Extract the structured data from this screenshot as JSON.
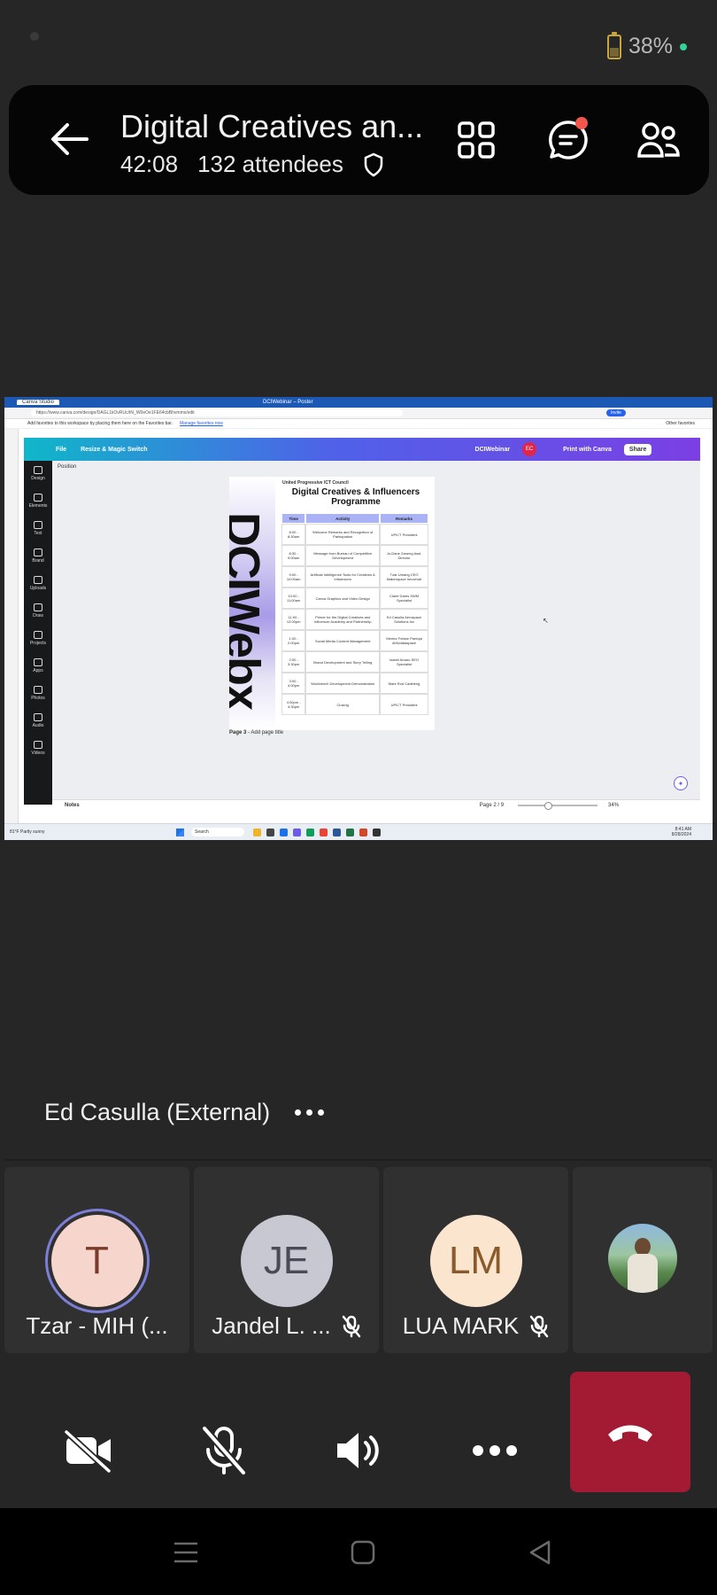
{
  "status_bar": {
    "battery": "38%"
  },
  "header": {
    "title": "Digital Creatives an...",
    "duration": "42:08",
    "attendees": "132 attendees"
  },
  "shared_screen": {
    "window_tab": "Canva Studio",
    "window_title": "DCIWebinar – Poster",
    "url": "https://www.canva.com/design/DAGL1kOvRUc/tN_W0eOe1FE64cbBhvmmx/edit",
    "invite": "Invite",
    "favbar_text": "Add favorites to this workspace by placing them here on the Favorites bar.",
    "favbar_link": "Manage favorites now",
    "other_favorites": "Other favorites",
    "canva": {
      "file": "File",
      "resize": "Resize & Magic Switch",
      "workspace_name": "DCIWebinar",
      "avatar": "EC",
      "print": "Print with Canva",
      "share": "Share",
      "position": "Position",
      "sidebar": [
        "Design",
        "Elements",
        "Text",
        "Brand",
        "Uploads",
        "Draw",
        "Projects",
        "Apps",
        "Photos",
        "Audio",
        "Videos"
      ],
      "page_label": "Page 3",
      "page_title_placeholder": "- Add page title",
      "notes": "Notes",
      "page_count": "Page 2 / 9",
      "zoom": "34%"
    },
    "poster": {
      "council": "United Progressive ICT Council",
      "title": "Digital Creatives & Influencers Programme",
      "side_word": "DCIWebx",
      "columns": [
        "Time",
        "Activity",
        "Remarks"
      ],
      "rows": [
        [
          "8:00 - 8:30am",
          "Welcome Remarks and Recognition of Participation",
          "UPICT President"
        ],
        [
          "8:30 - 9:00am",
          "Message from Bureau of Competitive Development",
          "Jo-Dane Zaneng Asst. Director"
        ],
        [
          "9:00 - 10:00am",
          "Artificial Intelligence Tools for Creatives & Influencers",
          "Tzar Umang CEO Makerspace Innovhub"
        ],
        [
          "10:00 - 11:00am",
          "Canva Graphics and Video Design",
          "Claire Dares SWM Specialist"
        ],
        [
          "11:00 - 12:00pm",
          "Primer for the Digital Creatives and Influencer Academy and Partnership",
          "Ed Casulla Aerospace Solutions Inc"
        ],
        [
          "1:00 - 2:00pm",
          "Social Media Content Management",
          "Mentor Felane Pantoja #MUdataspace"
        ],
        [
          "2:00 - 3:30pm",
          "Brand Development and Story Telling",
          "Isabel Amaro SEO Specialist"
        ],
        [
          "3:00 - 4:00pm",
          "Workbench Development Demonstration",
          "Mark Rod Cadeleng"
        ],
        [
          "4:00pm - 4:30pm",
          "Closing",
          "UPICT President"
        ]
      ]
    },
    "taskbar": {
      "weather": "81°F Partly sunny",
      "search": "Search",
      "time": "8:41 AM",
      "date": "8/28/2024"
    }
  },
  "presenter": {
    "name": "Ed Casulla (External)"
  },
  "participants": [
    {
      "initials": "T",
      "name": "Tzar - MIH (...",
      "muted": false,
      "bg": "#f6d6cc",
      "fg": "#7a3a2a"
    },
    {
      "initials": "JE",
      "name": "Jandel L. ...",
      "muted": true,
      "bg": "#c8c8d2",
      "fg": "#4a4a58"
    },
    {
      "initials": "LM",
      "name": "LUA MARK",
      "muted": true,
      "bg": "#fbe5cf",
      "fg": "#8a5a2a"
    }
  ],
  "colors": {
    "hangup": "#a31b33",
    "badge": "#f1574b",
    "accent": "#6e70c8"
  }
}
